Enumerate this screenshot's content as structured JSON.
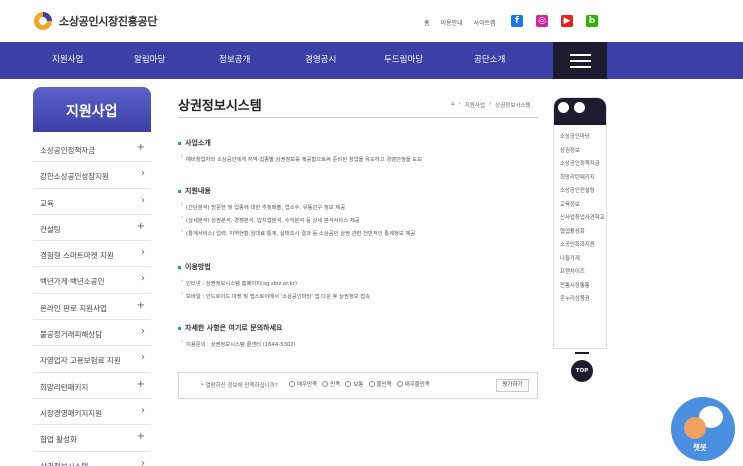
{
  "org": {
    "name": "소상공인시장진흥공단"
  },
  "header": {
    "util_links": [
      "홈",
      "이용안내",
      "사이트맵"
    ],
    "sns": [
      {
        "name": "facebook-icon",
        "glyph": "f",
        "color": "#1877f2"
      },
      {
        "name": "instagram-icon",
        "glyph": "◎",
        "color": "#d6249f"
      },
      {
        "name": "youtube-icon",
        "glyph": "▶",
        "color": "#e62117"
      },
      {
        "name": "blog-icon",
        "glyph": "b",
        "color": "#2db400"
      }
    ]
  },
  "gnb": [
    "지원사업",
    "알림마당",
    "정보공개",
    "경영공시",
    "두드림마당",
    "공단소개"
  ],
  "sidebar": {
    "title": "지원사업",
    "items": [
      {
        "label": "소상공인정책자금",
        "sym": "+"
      },
      {
        "label": "강한소상공인성장지원",
        "sym": "›"
      },
      {
        "label": "교육",
        "sym": "›"
      },
      {
        "label": "컨설팅",
        "sym": "+"
      },
      {
        "label": "경험형 스마트마켓 지원",
        "sym": "›"
      },
      {
        "label": "백년가게·백년소공인",
        "sym": "›"
      },
      {
        "label": "온라인 판로 지원사업",
        "sym": "+"
      },
      {
        "label": "불공정거래피해상담",
        "sym": "›"
      },
      {
        "label": "자영업자 고용보험료 지원",
        "sym": "›"
      },
      {
        "label": "희망리턴패키지",
        "sym": "+"
      },
      {
        "label": "시장경영패키지지원",
        "sym": "›"
      },
      {
        "label": "협업 활성화",
        "sym": "+"
      },
      {
        "label": "상권정보시스템",
        "sym": "›"
      }
    ]
  },
  "main": {
    "title": "상권정보시스템",
    "breadcrumb": [
      "지원사업",
      "상권정보시스템"
    ],
    "sections": [
      {
        "title": "사업소개",
        "lines": [
          "예비창업자와 소상공인에게 지역·업종별 상권정보를 제공함으로써 준비된 창업을 유도하고 경영안정을 도모"
        ]
      },
      {
        "title": "지원내용",
        "lines": [
          "(간단분석) 방문한 및 업종에 대한 추정매출, 업소수, 유동인구 정보 제공",
          "(상세분석) 상권분석, 경쟁분석, 입지업분석, 수익분석 등 상세 분석서비스 제공",
          "(통계서비스) 업력, 지역현황,임대료 통계, 실태조사 결과 등 소상공인 상권 관련 전반적인 통계정보 제공"
        ]
      },
      {
        "title": "이용방법",
        "lines": [
          "인터넷 : 상권정보시스템 홈페이지(sg.sbiz.or.kr)",
          "모바일 : 안드로이드 마켓 및 앱스토어에서 '소상공인마당' 앱 다운 후 상권정보 접속"
        ]
      },
      {
        "title": "자세한 사항은 여기로 문의하세요",
        "lines": [
          "이용문의 : 상권정보시스템 콜센터 (1644-5302)"
        ]
      }
    ],
    "survey": {
      "question": "* 열람하신 정보에 만족하십니까?",
      "options": [
        "매우만족",
        "만족",
        "보통",
        "불만족",
        "매우불만족"
      ],
      "button": "평가하기"
    }
  },
  "quick": {
    "items": [
      "소상공인마당",
      "상권정보",
      "소상공인정책자금",
      "희망리턴패키지",
      "소상공인컨설팅",
      "교육정보",
      "신사업창업사관학교",
      "협업활성화",
      "소공인특화지원",
      "나들가게",
      "프랜차이즈",
      "전통시장통통",
      "온누리상품권"
    ],
    "top_label": "TOP"
  },
  "chatbot": {
    "label": "챗봇"
  }
}
